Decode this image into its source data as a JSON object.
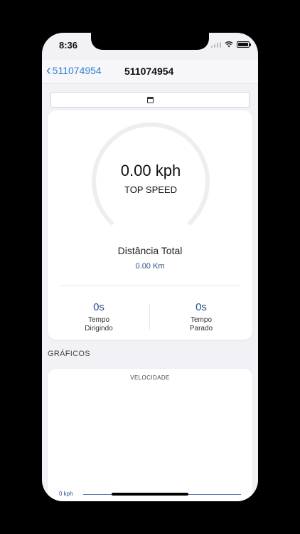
{
  "status_bar": {
    "time": "8:36"
  },
  "nav": {
    "back_label": "511074954",
    "title": "511074954"
  },
  "date_filter": {
    "icon": "calendar-icon"
  },
  "speed": {
    "value": "0.00 kph",
    "label": "TOP SPEED"
  },
  "distance": {
    "label": "Distância Total",
    "value": "0.00 Km"
  },
  "times": [
    {
      "value": "0s",
      "label_line1": "Tempo",
      "label_line2": "Dirigindo"
    },
    {
      "value": "0s",
      "label_line1": "Tempo",
      "label_line2": "Parado"
    }
  ],
  "charts_section": {
    "title": "GRÁFICOS"
  },
  "chart_data": {
    "type": "line",
    "title": "VELOCIDADE",
    "xlabel": "",
    "ylabel": "",
    "y_ticks": [
      "0 kph"
    ],
    "series": []
  },
  "colors": {
    "accent": "#2f7fd6",
    "value_blue": "#2a4f86",
    "background": "#f2f2f6"
  }
}
